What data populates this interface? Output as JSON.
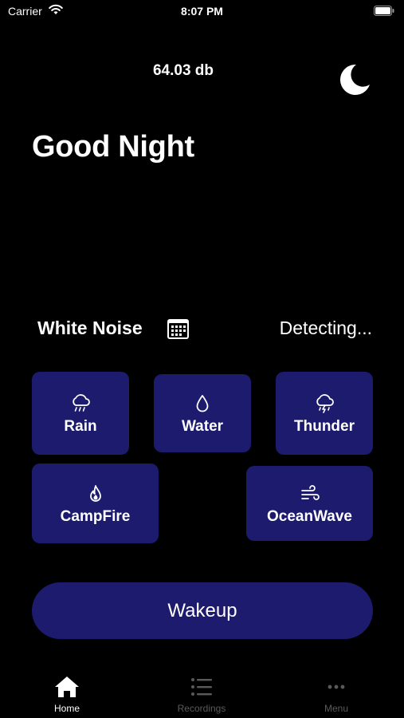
{
  "status_bar": {
    "carrier": "Carrier",
    "time": "8:07 PM"
  },
  "header": {
    "db_level": "64.03 db",
    "moon_icon": "moon-icon"
  },
  "greeting": "Good Night",
  "section": {
    "title": "White Noise",
    "status": "Detecting...",
    "icon": "calendar-icon"
  },
  "sounds": [
    {
      "label": "Rain",
      "icon": "rain-cloud-icon"
    },
    {
      "label": "Water",
      "icon": "water-drop-icon"
    },
    {
      "label": "Thunder",
      "icon": "thunder-cloud-icon"
    },
    {
      "label": "CampFire",
      "icon": "flame-icon"
    },
    {
      "label": "OceanWave",
      "icon": "wind-wave-icon"
    }
  ],
  "wakeup_button": "Wakeup",
  "tabs": [
    {
      "label": "Home",
      "icon": "home-icon",
      "active": true
    },
    {
      "label": "Recordings",
      "icon": "list-icon",
      "active": false
    },
    {
      "label": "Menu",
      "icon": "more-dots-icon",
      "active": false
    }
  ],
  "colors": {
    "background": "#000000",
    "button": "#1c1b6d",
    "text": "#ffffff",
    "inactive_tab": "#5a5a5a"
  }
}
